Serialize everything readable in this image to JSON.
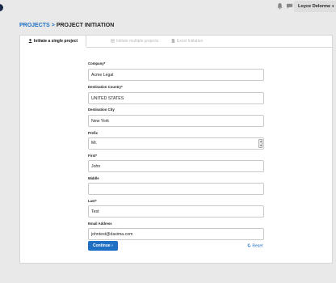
{
  "header": {
    "user_name": "Loyce Delorme",
    "caret": "▾"
  },
  "breadcrumb": {
    "parent": "PROJECTS",
    "separator": ">",
    "current": "PROJECT INITIATION"
  },
  "tabs": [
    {
      "label": "Initiate a single project",
      "icon": "user-icon",
      "active": true
    },
    {
      "label": "Initiate multiple projects",
      "icon": "list-icon",
      "active": false
    },
    {
      "label": "Excel Initiation",
      "icon": "file-icon",
      "active": false
    }
  ],
  "form": {
    "company": {
      "label": "Company*",
      "value": "Acme Legal"
    },
    "destination_country": {
      "label": "Destination Country*",
      "value": "UNITED STATES"
    },
    "destination_city": {
      "label": "Destination City",
      "value": "New York"
    },
    "prefix": {
      "label": "Prefix",
      "value": "Mr."
    },
    "first": {
      "label": "First*",
      "value": "John"
    },
    "middle": {
      "label": "Middle",
      "value": ""
    },
    "last": {
      "label": "Last*",
      "value": "Test"
    },
    "email": {
      "label": "Email Address",
      "value": "johntest@daxima.com"
    }
  },
  "actions": {
    "continue_label": "Continue",
    "continue_arrow": "›",
    "reset_label": "Reset",
    "reset_icon": "refresh-icon"
  },
  "colors": {
    "accent": "#1f6fc4",
    "background": "#e9e9e9",
    "panel": "#ffffff"
  }
}
